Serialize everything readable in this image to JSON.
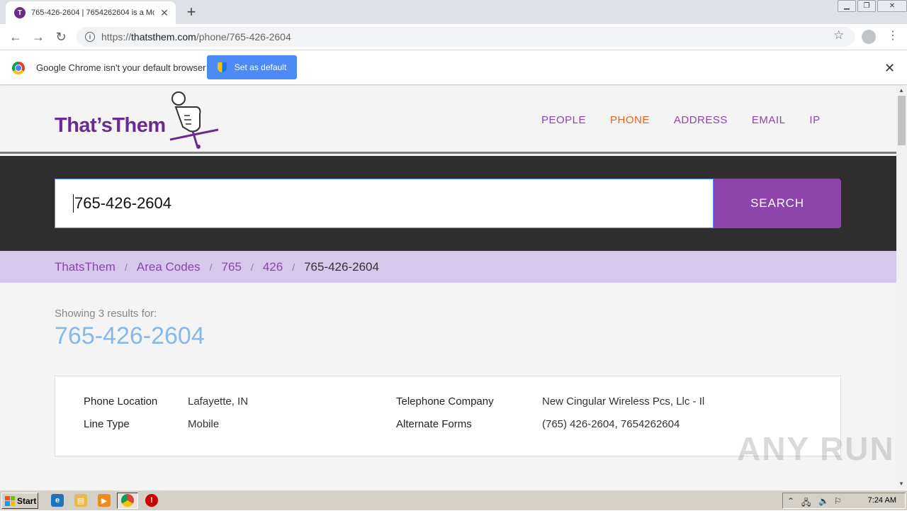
{
  "browser": {
    "tab_title": "765-426-2604 | 7654262604 is a Mo",
    "tab_favicon_letter": "T",
    "url_prefix": "https://",
    "url_host": "thatsthem.com",
    "url_path": "/phone/765-426-2604"
  },
  "infobar": {
    "message": "Google Chrome isn't your default browser",
    "button_label": "Set as default"
  },
  "site": {
    "logo_text": "That’sThem",
    "nav": [
      {
        "label": "PEOPLE",
        "active": false
      },
      {
        "label": "PHONE",
        "active": true
      },
      {
        "label": "ADDRESS",
        "active": false
      },
      {
        "label": "EMAIL",
        "active": false
      },
      {
        "label": "IP",
        "active": false
      }
    ],
    "search_value": "765-426-2604",
    "search_button": "SEARCH",
    "breadcrumbs": [
      "ThatsThem",
      "Area Codes",
      "765",
      "426"
    ],
    "breadcrumb_current": "765-426-2604",
    "breadcrumb_separator": "/",
    "showing_text": "Showing 3 results for:",
    "number_heading": "765-426-2604",
    "details": {
      "phone_location_label": "Phone Location",
      "phone_location_value": "Lafayette, IN",
      "line_type_label": "Line Type",
      "line_type_value": "Mobile",
      "telephone_company_label": "Telephone Company",
      "telephone_company_value": "New Cingular Wireless Pcs, Llc - Il",
      "alternate_forms_label": "Alternate Forms",
      "alternate_forms_value": "(765) 426-2604, 7654262604"
    },
    "colors": {
      "brand_purple": "#8e44ad",
      "active_orange": "#e0661f",
      "number_blue": "#86b8ea",
      "breadcrumb_bg": "#d6c7ec"
    }
  },
  "watermark": "ANY RUN",
  "taskbar": {
    "start_label": "Start",
    "clock": "7:24 AM"
  }
}
